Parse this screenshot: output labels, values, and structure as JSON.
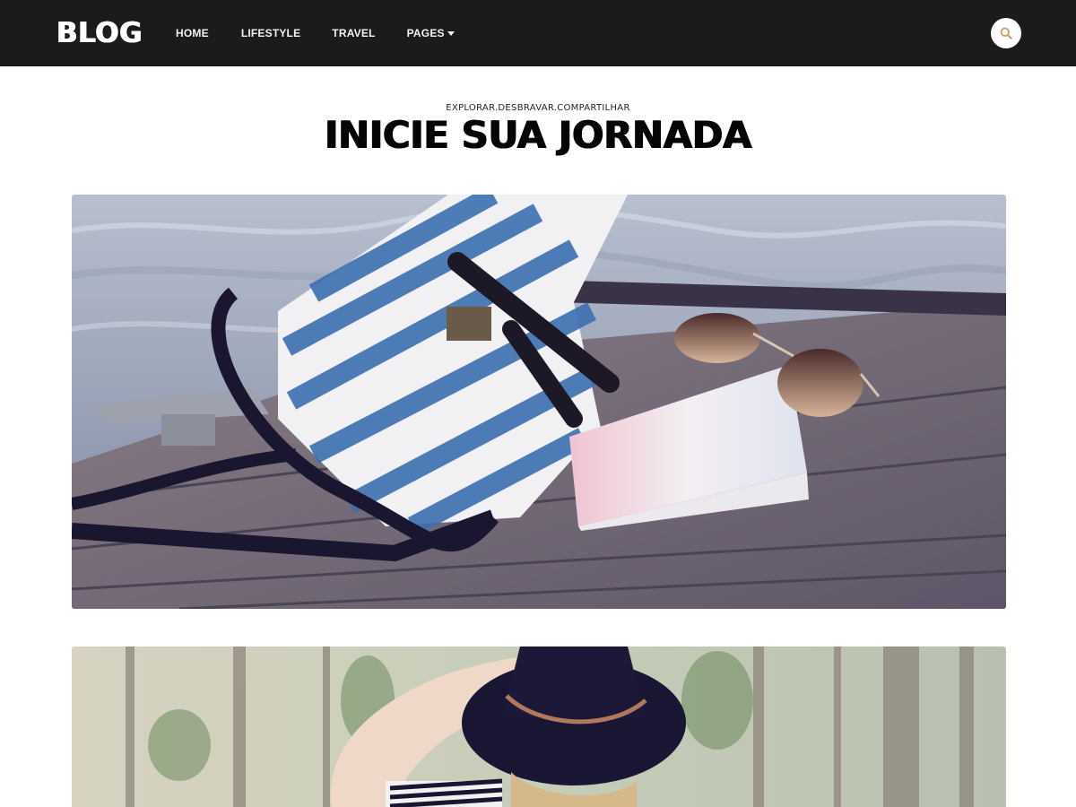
{
  "header": {
    "logo": "BLOG",
    "nav": [
      {
        "label": "HOME"
      },
      {
        "label": "LIFESTYLE"
      },
      {
        "label": "TRAVEL"
      },
      {
        "label": "PAGES",
        "has_dropdown": true
      }
    ],
    "search_icon": "search-icon",
    "colors": {
      "bar": "#1b1b1b",
      "accent": "#c9a36b"
    }
  },
  "hero": {
    "tagline": "EXPLORAR.DESBRAVAR.COMPARTILHAR",
    "title": "INICIE SUA JORNADA"
  },
  "posts": [
    {
      "image": "bag, book and sunglasses on a wooden dock"
    },
    {
      "image": "woman with black hat in a forest"
    }
  ]
}
